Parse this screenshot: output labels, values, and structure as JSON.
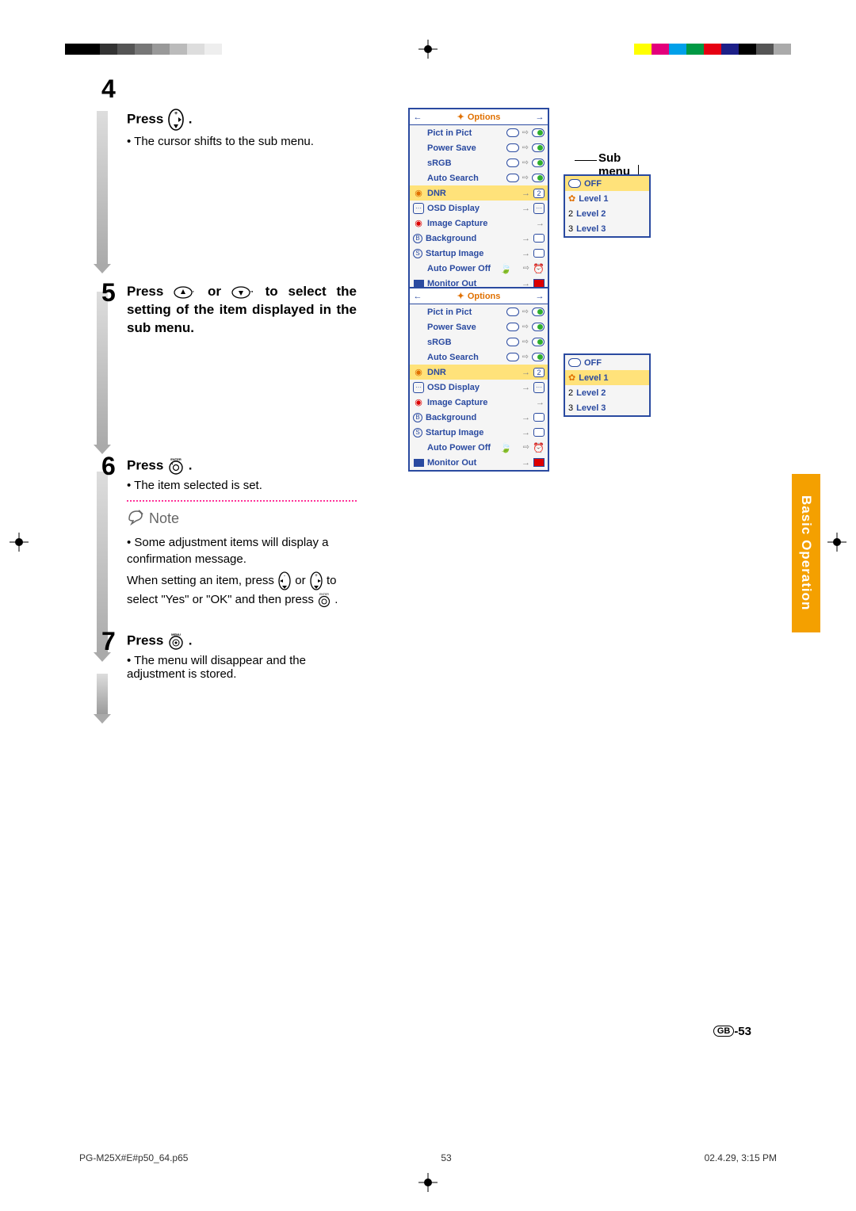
{
  "sidetab": "Basic Operation",
  "step4": {
    "num": "4",
    "headline_pre": "Press ",
    "headline_post": ".",
    "bullet": "The cursor shifts to the sub menu."
  },
  "step5": {
    "num": "5",
    "headline_a": "Press ",
    "headline_b": " or ",
    "headline_c": " to select the setting of the item displayed in the sub menu."
  },
  "step6": {
    "num": "6",
    "headline_pre": "Press ",
    "headline_post": ".",
    "icon_label": "ENTER",
    "bullet": "The item selected is set."
  },
  "note": {
    "title": "Note",
    "bullet": "Some adjustment items will display a confirmation message.",
    "line2a": "When setting an item, press ",
    "line2b": " or ",
    "line2c": " to select \"Yes\" or \"OK\" and then press ",
    "line2d": "."
  },
  "step7": {
    "num": "7",
    "headline_pre": "Press ",
    "headline_post": ".",
    "icon_label": "MENU",
    "bullet": "The menu will disappear and the adjustment is stored."
  },
  "osd": {
    "title": "Options",
    "rows": [
      {
        "label": "Pict in Pict",
        "toggle": true
      },
      {
        "label": "Power Save",
        "toggle": true
      },
      {
        "label": "sRGB",
        "toggle": true
      },
      {
        "label": "Auto Search",
        "toggle": true
      },
      {
        "label": "DNR",
        "hl": true,
        "num": "2"
      },
      {
        "label": "OSD Display",
        "osd": true
      },
      {
        "label": "Image Capture",
        "plain": true
      },
      {
        "label": "Background",
        "endbox": true
      },
      {
        "label": "Startup Image",
        "endbox": true
      },
      {
        "label": "Auto Power Off",
        "leaf": true,
        "clock": true
      },
      {
        "label": "Monitor Out",
        "monitor": true
      }
    ]
  },
  "submenu1": {
    "label": "Sub menu",
    "rows": [
      {
        "label": "OFF",
        "off": true,
        "hl": false
      },
      {
        "label": "Level 1",
        "hl": false,
        "icon": "gear"
      },
      {
        "label": "Level 2",
        "hl": false,
        "icon": "2"
      },
      {
        "label": "Level 3",
        "hl": false,
        "icon": "3"
      }
    ],
    "hl": 0
  },
  "submenu2": {
    "rows": [
      {
        "label": "OFF",
        "off": true
      },
      {
        "label": "Level 1",
        "icon": "gear",
        "hl": true
      },
      {
        "label": "Level 2",
        "icon": "2"
      },
      {
        "label": "Level 3",
        "icon": "3"
      }
    ]
  },
  "pagenum": {
    "gb": "GB",
    "num": "-53"
  },
  "footer": {
    "left": "PG-M25X#E#p50_64.p65",
    "center": "53",
    "right": "02.4.29, 3:15 PM"
  }
}
